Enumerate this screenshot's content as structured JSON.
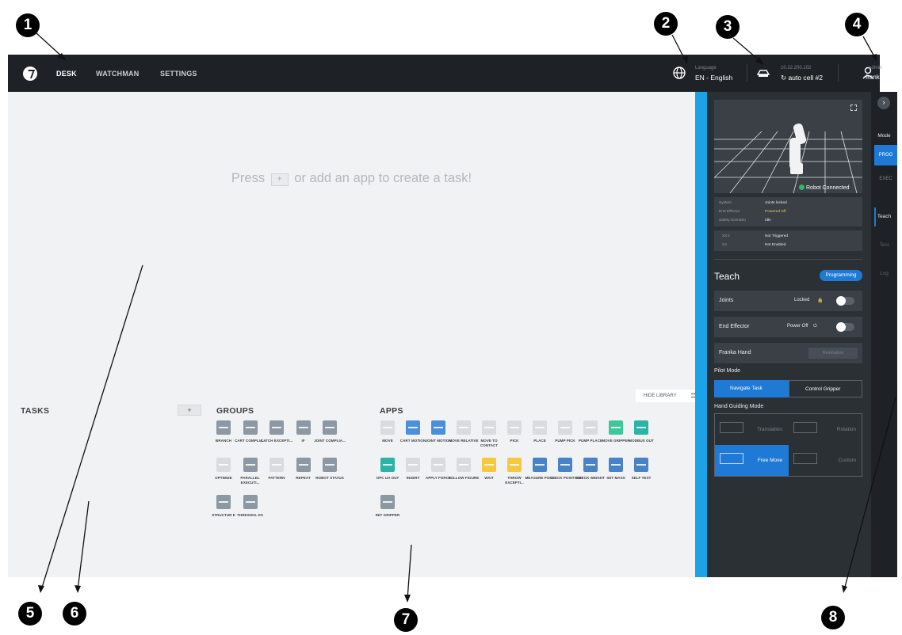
{
  "topbar": {
    "nav": [
      "DESK",
      "WATCHMAN",
      "SETTINGS"
    ],
    "language_label": "Language",
    "language_value": "EN - English",
    "ip_address": "10.22.200.102",
    "cell_name": "auto cell #2",
    "user_role": "admin",
    "user_name": "franka"
  },
  "canvas": {
    "empty_prefix": "Press",
    "empty_plus": "+",
    "empty_suffix": "or add an app to create a task!",
    "hide_library": "HIDE LIBRARY",
    "tasks_title": "TASKS",
    "add_task": "+",
    "groups_title": "GROUPS",
    "apps_title": "APPS",
    "groups": [
      {
        "label": "BRANCH",
        "color": "#8c98a4",
        "disabled": false
      },
      {
        "label": "CART COMPLIA...",
        "color": "#8c98a4",
        "disabled": false
      },
      {
        "label": "CATCH EXCEPTI...",
        "color": "#8c98a4",
        "disabled": false
      },
      {
        "label": "IF",
        "color": "#8c98a4",
        "disabled": false
      },
      {
        "label": "JOINT COMPLIA...",
        "color": "#8c98a4",
        "disabled": false
      },
      {
        "label": "OPTIMIZE",
        "color": "#d9dcdf",
        "disabled": true
      },
      {
        "label": "PARALLEL EXECUTI...",
        "color": "#8c98a4",
        "disabled": false
      },
      {
        "label": "PATTERN",
        "color": "#d9dcdf",
        "disabled": true
      },
      {
        "label": "REPEAT",
        "color": "#8c98a4",
        "disabled": false
      },
      {
        "label": "ROBOT STATUS",
        "color": "#8c98a4",
        "disabled": false
      },
      {
        "label": "STRUCTUR E",
        "color": "#8c98a4",
        "disabled": false
      },
      {
        "label": "THRESHOL DS",
        "color": "#8c98a4",
        "disabled": false
      }
    ],
    "apps": [
      {
        "label": "MOVE",
        "color": "#d9dcdf",
        "disabled": true
      },
      {
        "label": "CART MOTION",
        "color": "#4a90d9",
        "disabled": false
      },
      {
        "label": "JOINT MOTION",
        "color": "#4a90d9",
        "disabled": false
      },
      {
        "label": "MOVE RELATIVE",
        "color": "#d9dcdf",
        "disabled": true
      },
      {
        "label": "MOVE TO CONTACT",
        "color": "#d9dcdf",
        "disabled": true
      },
      {
        "label": "PICK",
        "color": "#d9dcdf",
        "disabled": true
      },
      {
        "label": "PLACE",
        "color": "#d9dcdf",
        "disabled": true
      },
      {
        "label": "PUMP PICK",
        "color": "#d9dcdf",
        "disabled": true
      },
      {
        "label": "PUMP PLACE",
        "color": "#d9dcdf",
        "disabled": true
      },
      {
        "label": "MOVE GRIPPER",
        "color": "#3ec79a",
        "disabled": false
      },
      {
        "label": "MODBUS OUT",
        "color": "#2bb3a8",
        "disabled": false
      },
      {
        "label": "OPC UA OUT",
        "color": "#2bb3a8",
        "disabled": false
      },
      {
        "label": "INSERT",
        "color": "#d9dcdf",
        "disabled": true
      },
      {
        "label": "APPLY FORCE",
        "color": "#d9dcdf",
        "disabled": true
      },
      {
        "label": "FOLLOW FIGURE",
        "color": "#d9dcdf",
        "disabled": true
      },
      {
        "label": "WAIT",
        "color": "#f5c842",
        "disabled": false
      },
      {
        "label": "THROW EXCEPTI...",
        "color": "#f5c842",
        "disabled": false
      },
      {
        "label": "MEASURE POSE",
        "color": "#4a82c8",
        "disabled": false
      },
      {
        "label": "CHECK POSITION",
        "color": "#4a82c8",
        "disabled": false
      },
      {
        "label": "CHECK WEIGHT",
        "color": "#4a82c8",
        "disabled": false
      },
      {
        "label": "SET MASS",
        "color": "#4a82c8",
        "disabled": false
      },
      {
        "label": "SELF TEST",
        "color": "#4a82c8",
        "disabled": false
      },
      {
        "label": "INIT GRIPPER",
        "color": "#8c98a4",
        "disabled": false
      }
    ]
  },
  "panel": {
    "robot_connected": "Robot Connected",
    "status": [
      {
        "key": "System",
        "value": "Joints locked",
        "warn": false
      },
      {
        "key": "End Effector",
        "value": "Powered Off",
        "warn": true
      },
      {
        "key": "Safety Scenario",
        "value": "Idle",
        "warn": false
      }
    ],
    "io": [
      {
        "key": "X3.1",
        "value": "Not Triggered"
      },
      {
        "key": "X4",
        "value": "Not Enabled"
      }
    ],
    "teach_title": "Teach",
    "teach_pill": "Programming",
    "joints_label": "Joints",
    "joints_state": "Locked",
    "end_effector_label": "End Effector",
    "end_effector_state": "Power Off",
    "hand_label": "Franka Hand",
    "reinit_label": "Reinitialize",
    "pilot_mode_label": "Pilot Mode",
    "pilot_navigate": "Navigate Task",
    "pilot_control": "Control Gripper",
    "hand_guiding_label": "Hand Guiding Mode",
    "hg_translation": "Translation",
    "hg_rotation": "Rotation",
    "hg_free": "Free Move",
    "hg_custom": "Custom"
  },
  "rail": {
    "mode_title": "Mode",
    "prog": "PROG",
    "exec": "EXEC",
    "teach": "Teach",
    "test": "Test",
    "log": "Log"
  },
  "callouts": [
    "1",
    "2",
    "3",
    "4",
    "5",
    "6",
    "7",
    "8"
  ],
  "colors": {
    "topbar": "#1e2226",
    "canvas": "#f1f2f3",
    "accent": "#1aa3e8",
    "panel": "#2b3035",
    "active_blue": "#1f7ad6"
  }
}
